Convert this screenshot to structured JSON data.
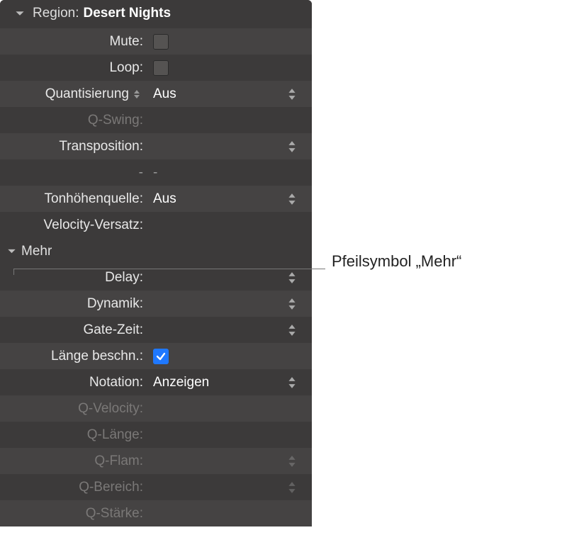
{
  "header": {
    "prefix": "Region:",
    "title": "Desert Nights"
  },
  "rows": {
    "mute": {
      "label": "Mute:"
    },
    "loop": {
      "label": "Loop:"
    },
    "quantize": {
      "label": "Quantisierung",
      "value": "Aus"
    },
    "qswing": {
      "label": "Q-Swing:"
    },
    "transpose": {
      "label": "Transposition:"
    },
    "dash": {
      "left": "-",
      "right": "-"
    },
    "pitchsource": {
      "label": "Tonhöhenquelle:",
      "value": "Aus"
    },
    "veloffset": {
      "label": "Velocity-Versatz:"
    }
  },
  "section_more": {
    "label": "Mehr"
  },
  "more_rows": {
    "delay": {
      "label": "Delay:"
    },
    "dynamik": {
      "label": "Dynamik:"
    },
    "gate": {
      "label": "Gate-Zeit:"
    },
    "clip": {
      "label": "Länge beschn.:"
    },
    "notation": {
      "label": "Notation:",
      "value": "Anzeigen"
    },
    "qvel": {
      "label": "Q-Velocity:"
    },
    "qlen": {
      "label": "Q-Länge:"
    },
    "qflam": {
      "label": "Q-Flam:"
    },
    "qrange": {
      "label": "Q-Bereich:"
    },
    "qstrength": {
      "label": "Q-Stärke:"
    }
  },
  "callout": {
    "text": "Pfeilsymbol „Mehr“"
  }
}
